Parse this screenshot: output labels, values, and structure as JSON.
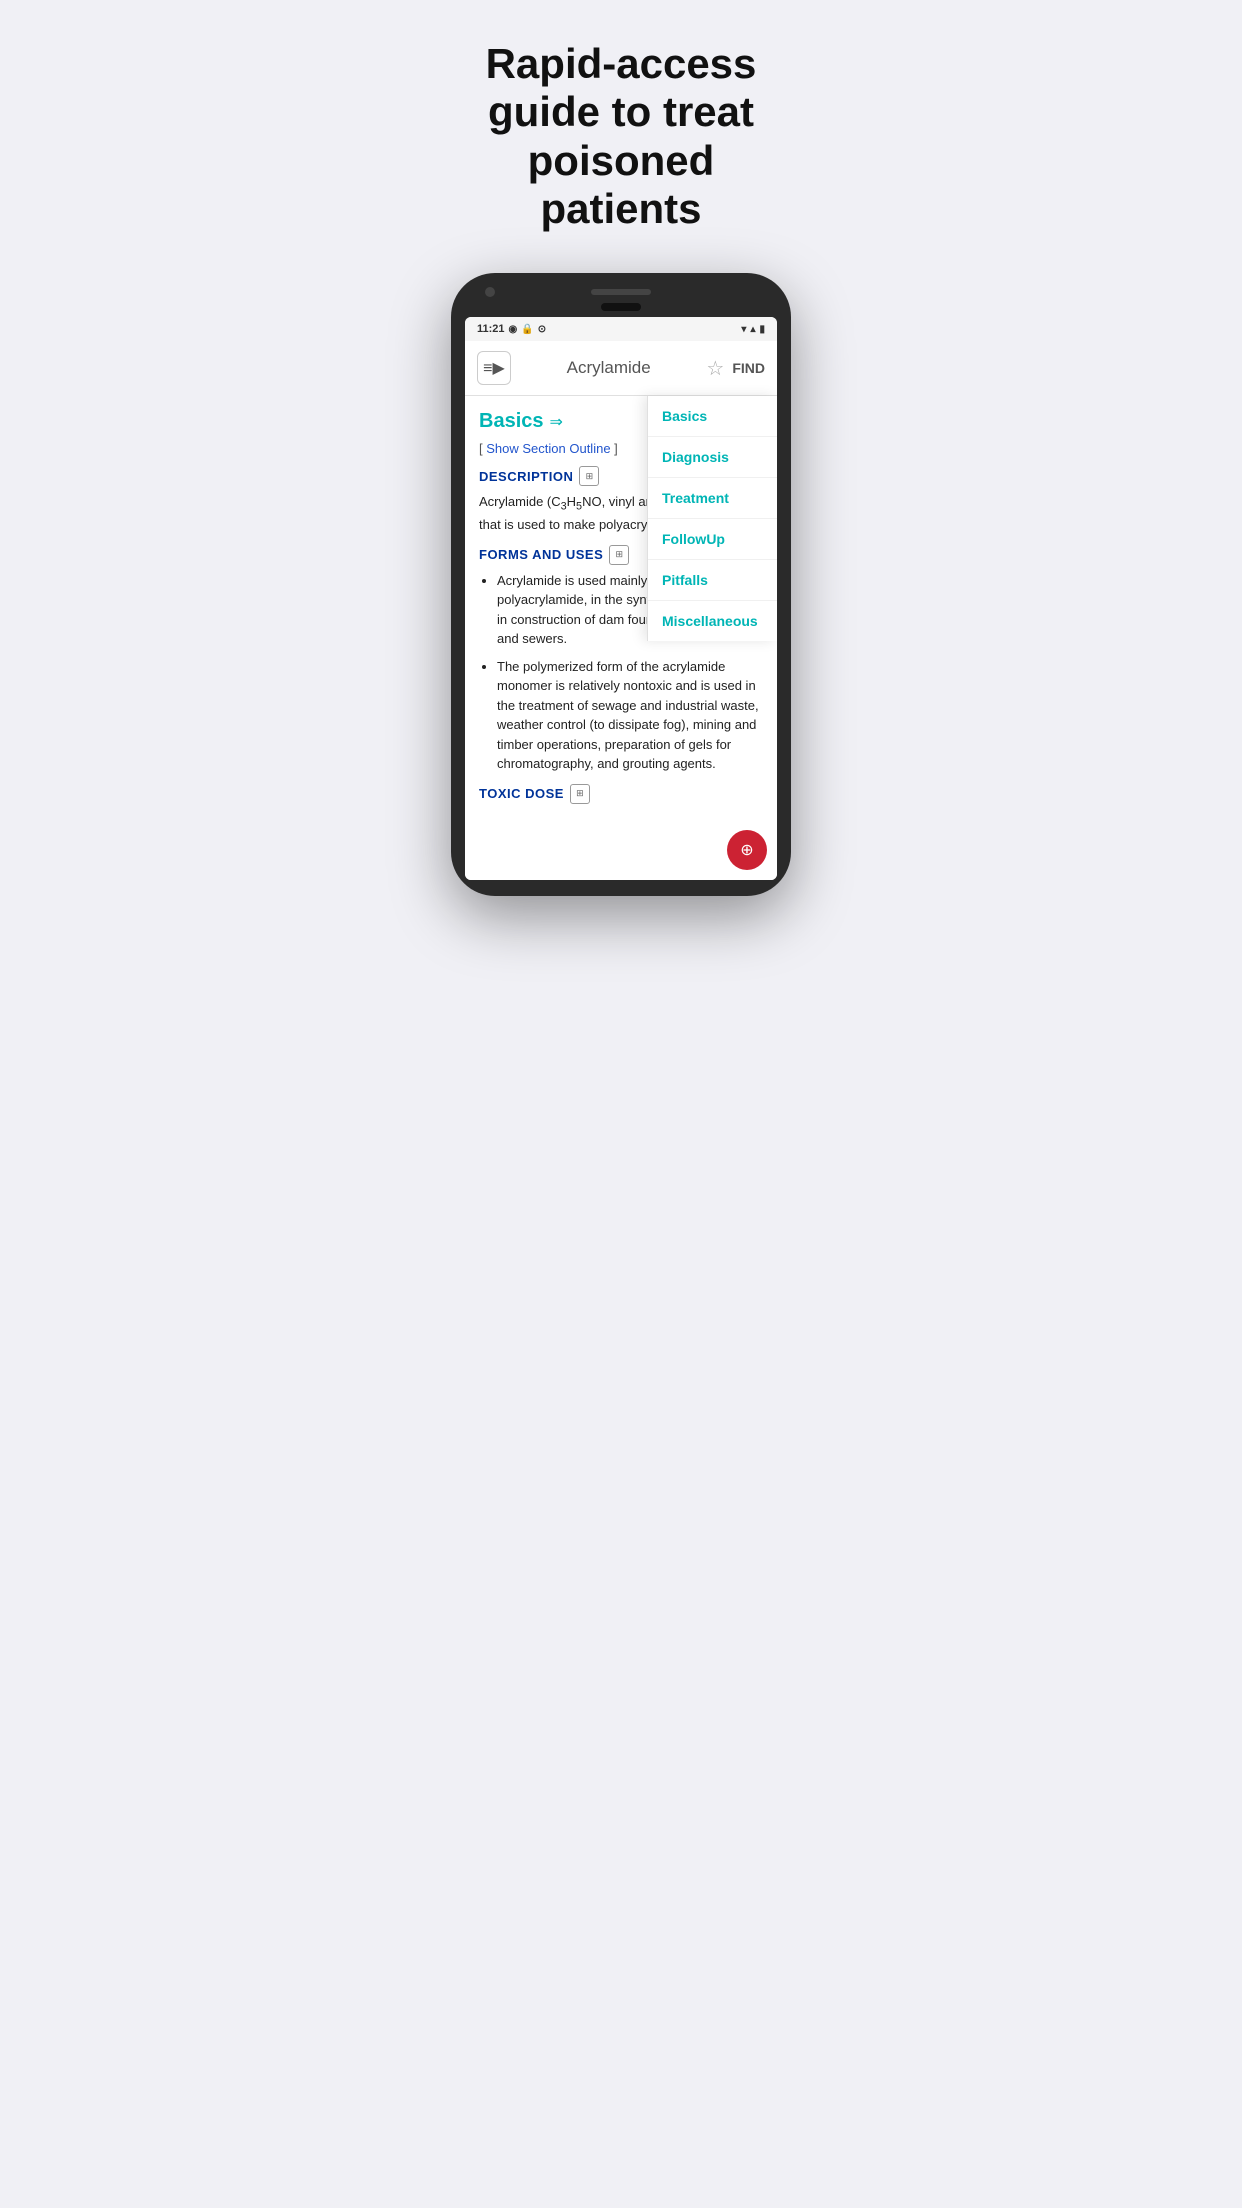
{
  "hero": {
    "title": "Rapid-access guide to treat poisoned patients"
  },
  "phone": {
    "status_bar": {
      "time": "11:21",
      "wifi_icon": "▼",
      "signal_icon": "▲",
      "battery_icon": "▮"
    },
    "nav": {
      "logo_icon": "≡▶",
      "title": "Acrylamide",
      "star_icon": "☆",
      "find_label": "FIND"
    },
    "sidebar": {
      "items": [
        {
          "label": "Basics"
        },
        {
          "label": "Diagnosis"
        },
        {
          "label": "Treatment"
        },
        {
          "label": "FollowUp"
        },
        {
          "label": "Pitfalls"
        },
        {
          "label": "Miscellaneous"
        }
      ]
    },
    "content": {
      "section_label": "Basics",
      "show_outline_prefix": "[",
      "show_outline_link": "Show Section Outline",
      "show_outline_suffix": "]",
      "description_header": "DESCRIPTION",
      "description_text": "Acrylamide (C₃H₅NO, vinyl amide vinyl monomer that is used to make polyacrylamide.",
      "forms_header": "FORMS AND USES",
      "bullet1": "Acrylamide is used mainly in the production of polyacrylamide, in the synthesis of dyes, and in construction of dam foundations, tunnels, and sewers.",
      "bullet2": "The polymerized form of the acrylamide monomer is relatively nontoxic and is used in the treatment of sewage and industrial waste, weather control (to dissipate fog), mining and timber operations, preparation of gels for chromatography, and grouting agents.",
      "toxic_dose_header": "TOXIC DOSE",
      "fab_icon": "⊕"
    }
  }
}
